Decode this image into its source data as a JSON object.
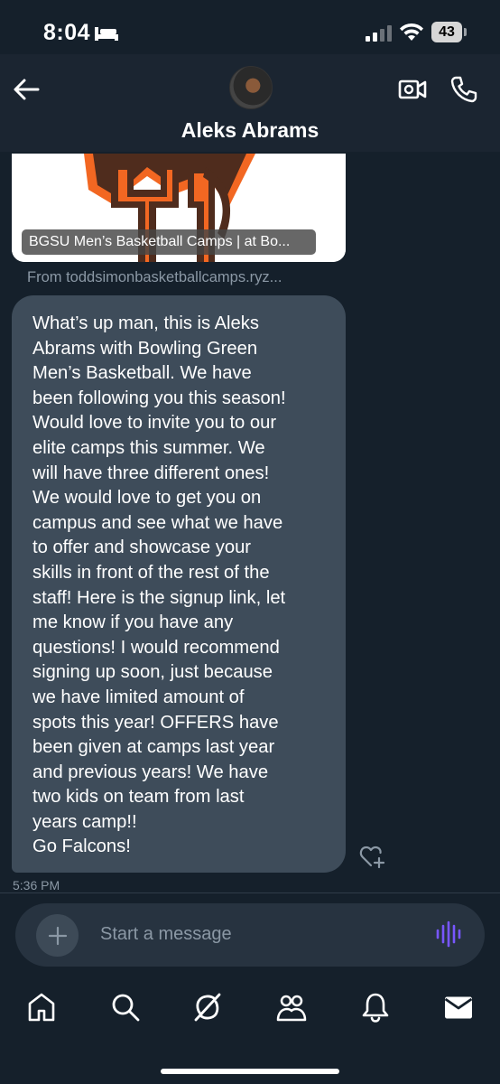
{
  "status_bar": {
    "time": "8:04",
    "battery": "43"
  },
  "header": {
    "contact_name": "Aleks Abrams"
  },
  "link_card": {
    "title": "BGSU Men’s Basketball Camps | at Bo...",
    "source": "From toddsimonbasketballcamps.ryz..."
  },
  "message": {
    "text": "What’s up man, this is Aleks\nAbrams with Bowling Green\nMen’s Basketball. We have\nbeen following you this season!\nWould love to invite you to our\nelite camps this summer. We\nwill have three different ones!\nWe would love to get you on\ncampus and see what we have\nto offer and showcase your\nskills in front of the rest of the\nstaff! Here is the signup link, let\nme know if you have any\nquestions! I would recommend\nsigning up soon, just because\nwe have limited amount of\nspots this year! OFFERS have\nbeen given at camps last year\nand previous years! We have\ntwo kids on team from last\nyears camp!!\nGo Falcons!",
    "time": "5:36 PM"
  },
  "composer": {
    "placeholder": "Start a message"
  },
  "colors": {
    "background": "#15202b",
    "bubble": "#3e4c5a",
    "accent": "#7856ff"
  },
  "icons": {
    "nav": [
      "home-icon",
      "search-icon",
      "grok-icon",
      "communities-icon",
      "notifications-icon",
      "messages-icon"
    ]
  }
}
